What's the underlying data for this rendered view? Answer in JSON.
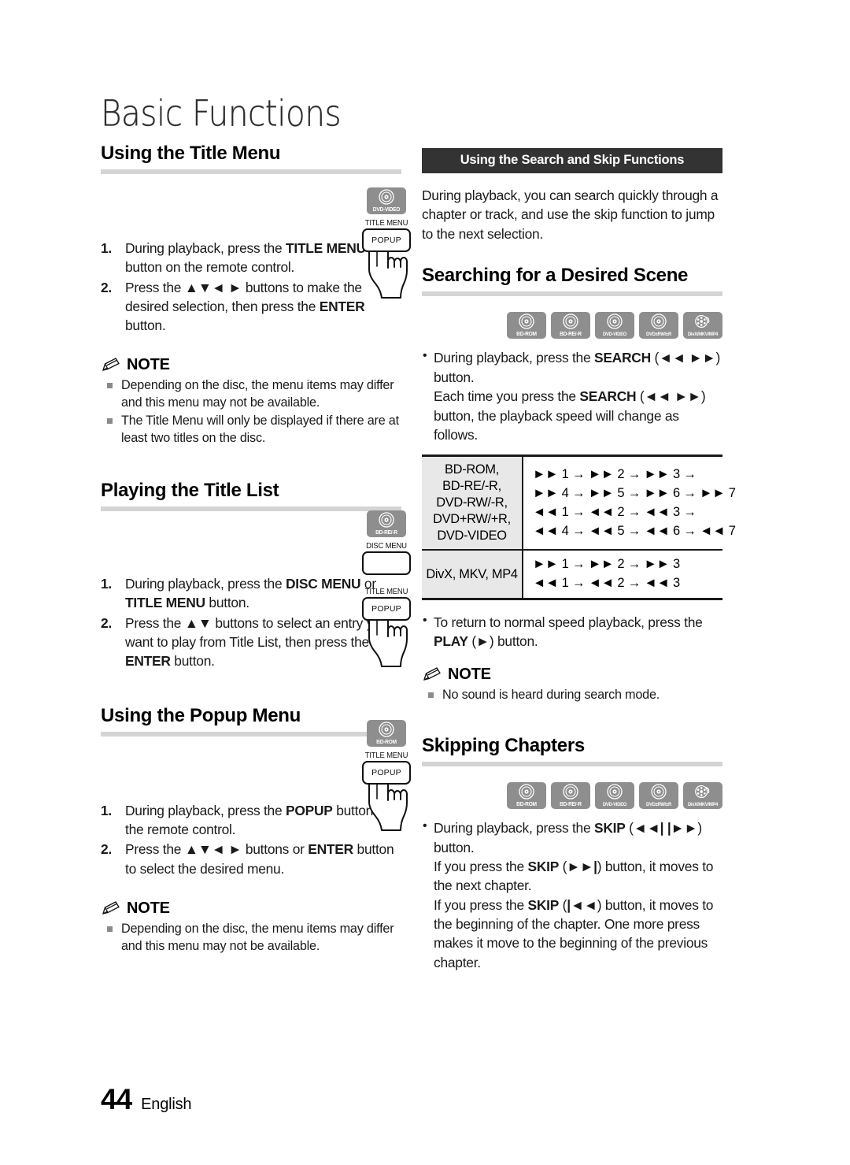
{
  "document": {
    "chapter_title": "Basic Functions",
    "page_number": "44",
    "language": "English"
  },
  "left_column": {
    "section1": {
      "heading": "Using the Title Menu",
      "steps": [
        {
          "num": "1.",
          "html": "During playback, press the <b>TITLE MENU</b> button on the remote control."
        },
        {
          "num": "2.",
          "html": "Press the <b>▲▼◄ ►</b> buttons to make the desired selection, then press the <b>ENTER</b> button."
        }
      ],
      "note_label": "NOTE",
      "notes": [
        "Depending on the disc, the menu items may differ and this menu may not be available.",
        "The Title Menu will only be displayed if there are at least two titles on the disc."
      ],
      "illustration": {
        "badge": "DVD-VIDEO",
        "button_label": "TITLE MENU",
        "button_inner": "POPUP"
      }
    },
    "section2": {
      "heading": "Playing the Title List",
      "steps": [
        {
          "num": "1.",
          "html": "During playback, press the <b>DISC MENU</b> or <b>TITLE MENU</b> button."
        },
        {
          "num": "2.",
          "html": "Press the <b>▲▼</b> buttons to select an entry you want to play from Title List, then press the <b>ENTER</b> button."
        }
      ],
      "illustration": {
        "badge": "BD-RE/-R",
        "button1_label": "DISC MENU",
        "button1_inner": "",
        "button2_label": "TITLE MENU",
        "button2_inner": "POPUP"
      }
    },
    "section3": {
      "heading": "Using the Popup Menu",
      "steps": [
        {
          "num": "1.",
          "html": "During playback, press the <b>POPUP</b> button on the remote control."
        },
        {
          "num": "2.",
          "html": "Press the <b>▲▼◄ ►</b> buttons or <b>ENTER</b> button to select the desired menu."
        }
      ],
      "note_label": "NOTE",
      "notes": [
        "Depending on the disc, the menu items may differ and this menu may not be available."
      ],
      "illustration": {
        "badge": "BD-ROM",
        "button_label": "TITLE MENU",
        "button_inner": "POPUP"
      }
    }
  },
  "right_column": {
    "banner": "Using the Search and Skip Functions",
    "intro": "During playback, you can search quickly through a chapter or track, and use the skip function to jump to the next selection.",
    "section_search": {
      "heading": "Searching for a Desired Scene",
      "badges": [
        "BD-ROM",
        "BD-RE/-R",
        "DVD-VIDEO",
        "DVD±RW/±R",
        "DivX/MKV/MP4"
      ],
      "bullets": [
        "During playback, press the <b>SEARCH</b> (<b>◄◄ ►►</b>) button.<br>Each time you press the <b>SEARCH</b> (<b>◄◄ ►►</b>) button, the playback speed will change as follows."
      ],
      "table": {
        "rows": [
          {
            "discs": [
              "BD-ROM,",
              "BD-RE/-R,",
              "DVD-RW/-R,",
              "DVD+RW/+R,",
              "DVD-VIDEO"
            ],
            "sequences": [
              "►► 1 → ►► 2 → ►► 3 →",
              "►► 4 → ►► 5 → ►► 6 → ►► 7",
              "◄◄ 1 → ◄◄ 2 → ◄◄ 3 →",
              "◄◄ 4 → ◄◄ 5 → ◄◄ 6 → ◄◄ 7"
            ]
          },
          {
            "discs": [
              "DivX, MKV, MP4"
            ],
            "sequences": [
              "►► 1 → ►► 2 → ►► 3",
              "◄◄ 1 → ◄◄ 2 → ◄◄ 3"
            ]
          }
        ]
      },
      "bullet_after": "To return to normal speed playback, press the <b>PLAY</b> (<b>►</b>) button.",
      "note_label": "NOTE",
      "notes": [
        "No sound is heard during search mode."
      ]
    },
    "section_skip": {
      "heading": "Skipping Chapters",
      "badges": [
        "BD-ROM",
        "BD-RE/-R",
        "DVD-VIDEO",
        "DVD±RW/±R",
        "DivX/MKV/MP4"
      ],
      "bullets": [
        "During playback, press the <b>SKIP</b> (<b>◄◄| |►►</b>) button.<br>If you press the <b>SKIP</b> (<b>►►|</b>) button, it moves to the next chapter.<br>If you press the <b>SKIP</b> (<b>|◄◄</b>) button, it moves to the beginning of the chapter. One more press makes it move to the beginning of the previous chapter."
      ]
    }
  },
  "colors": {
    "banner_bg": "#333333",
    "rule": "#d4d4d4",
    "badge_bg": "#8e8e8e",
    "table_cell_bg": "#e8e8e8"
  }
}
